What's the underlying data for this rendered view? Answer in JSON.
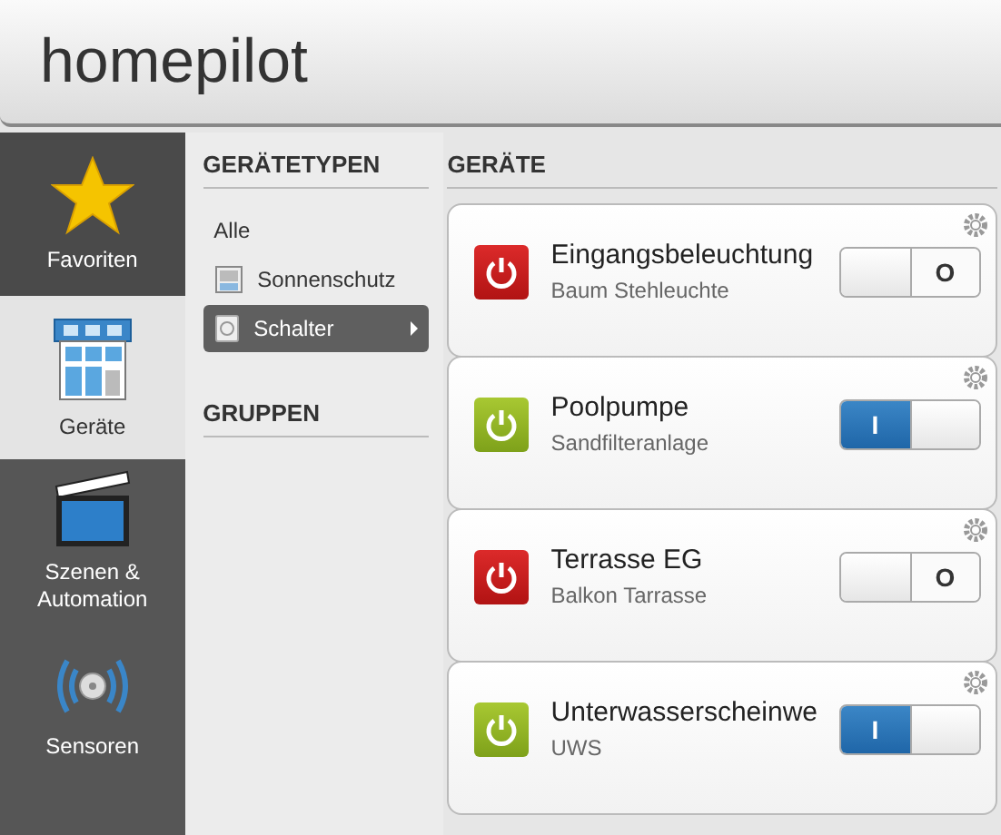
{
  "header": {
    "logo": "homepilot"
  },
  "nav": [
    {
      "label": "Favoriten",
      "kind": "star",
      "selected": false
    },
    {
      "label": "Geräte",
      "kind": "house",
      "selected": true
    },
    {
      "label": "Szenen & Automation",
      "kind": "clapper",
      "selected": false
    },
    {
      "label": "Sensoren",
      "kind": "sensor",
      "selected": false
    }
  ],
  "types": {
    "title": "GERÄTETYPEN",
    "items": [
      {
        "label": "Alle",
        "kind": "all",
        "selected": false
      },
      {
        "label": "Sonnenschutz",
        "kind": "shade",
        "selected": false
      },
      {
        "label": "Schalter",
        "kind": "socket",
        "selected": true
      }
    ]
  },
  "groups": {
    "title": "GRUPPEN"
  },
  "devices": {
    "title": "GERÄTE",
    "items": [
      {
        "name": "Eingangsbeleuchtung",
        "sub": "Baum Stehleuchte",
        "on": false,
        "switch_text": "O"
      },
      {
        "name": "Poolpumpe",
        "sub": "Sandfilteranlage",
        "on": true,
        "switch_text": "I"
      },
      {
        "name": "Terrasse EG",
        "sub": "Balkon Tarrasse",
        "on": false,
        "switch_text": "O"
      },
      {
        "name": "Unterwasserscheinwe",
        "sub": "UWS",
        "on": true,
        "switch_text": "I"
      }
    ]
  }
}
